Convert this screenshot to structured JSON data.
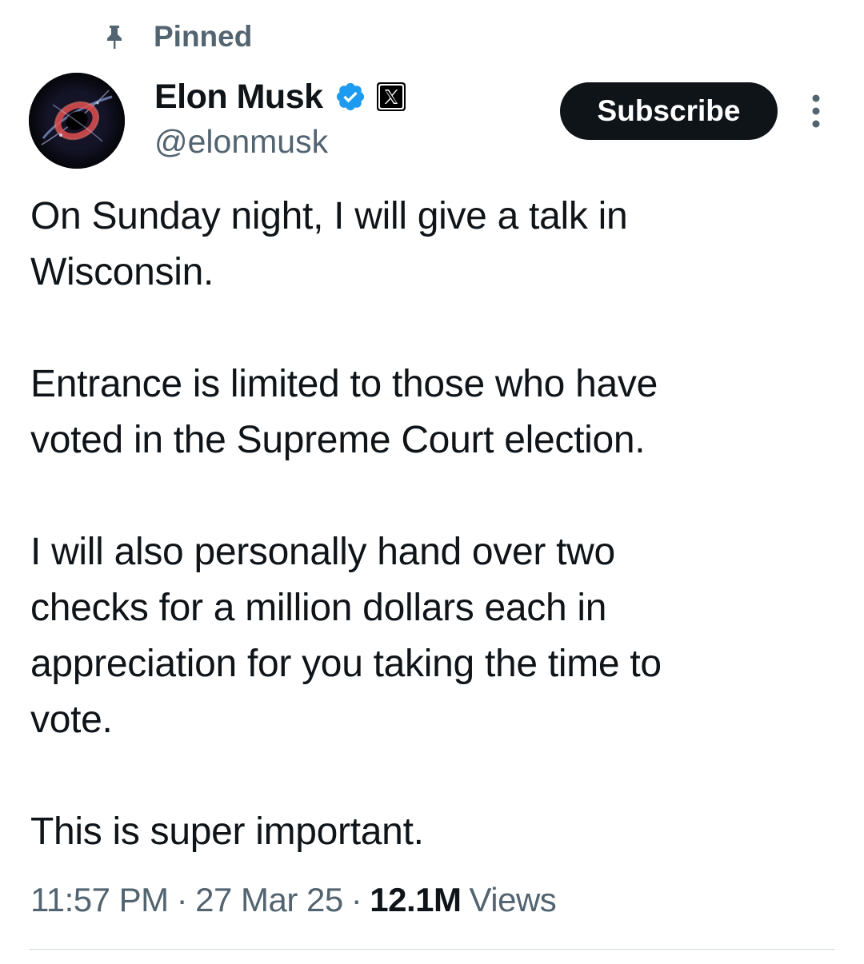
{
  "header": {
    "pinned_label": "Pinned"
  },
  "author": {
    "display_name": "Elon Musk",
    "handle": "@elonmusk",
    "verified": true,
    "affiliate_badge": "x-logo-icon",
    "avatar_icon": "black-hole-avatar"
  },
  "actions": {
    "subscribe_label": "Subscribe",
    "more_icon": "more-vertical-icon"
  },
  "tweet": {
    "paragraphs": [
      "On Sunday night, I will give a talk in\nWisconsin.",
      "Entrance is limited to those who have\nvoted in the Supreme Court election.",
      "I will also personally hand over two\nchecks for a million dollars each in\nappreciation for you taking the time to\nvote.",
      "This is super important."
    ]
  },
  "meta": {
    "time": "11:57 PM",
    "separator": "·",
    "date": "27 Mar 25",
    "views_count": "12.1M",
    "views_label": "Views"
  },
  "colors": {
    "text_primary": "#0f1419",
    "text_secondary": "#536471",
    "verified_blue": "#1d9bf0",
    "button_bg": "#0f1419",
    "divider": "#cfd9de"
  }
}
